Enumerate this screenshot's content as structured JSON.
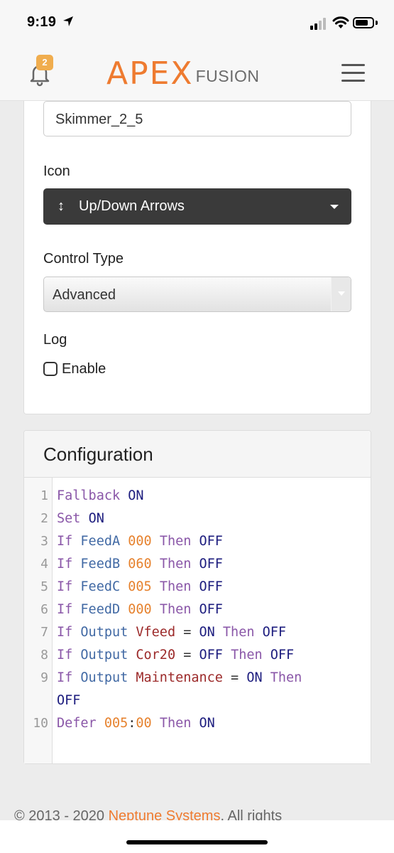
{
  "status_bar": {
    "time": "9:19"
  },
  "navbar": {
    "notification_count": "2",
    "logo_primary": "APEX",
    "logo_secondary": "FUSION"
  },
  "form": {
    "name_value": "Skimmer_2_5",
    "icon_label": "Icon",
    "icon_value": "Up/Down Arrows",
    "control_type_label": "Control Type",
    "control_type_value": "Advanced",
    "log_label": "Log",
    "enable_label": "Enable",
    "enable_checked": false
  },
  "configuration": {
    "title": "Configuration",
    "line_numbers": [
      "1",
      "2",
      "3",
      "4",
      "5",
      "6",
      "7",
      "8",
      "9",
      "",
      "10"
    ],
    "lines": [
      [
        [
          "kw",
          "Fallback "
        ],
        [
          "st",
          "ON"
        ]
      ],
      [
        [
          "kw",
          "Set "
        ],
        [
          "st",
          "ON"
        ]
      ],
      [
        [
          "kw",
          "If "
        ],
        [
          "var",
          "FeedA "
        ],
        [
          "num",
          "000 "
        ],
        [
          "kw",
          "Then "
        ],
        [
          "st",
          "OFF"
        ]
      ],
      [
        [
          "kw",
          "If "
        ],
        [
          "var",
          "FeedB "
        ],
        [
          "num",
          "060 "
        ],
        [
          "kw",
          "Then "
        ],
        [
          "st",
          "OFF"
        ]
      ],
      [
        [
          "kw",
          "If "
        ],
        [
          "var",
          "FeedC "
        ],
        [
          "num",
          "005 "
        ],
        [
          "kw",
          "Then "
        ],
        [
          "st",
          "OFF"
        ]
      ],
      [
        [
          "kw",
          "If "
        ],
        [
          "var",
          "FeedD "
        ],
        [
          "num",
          "000 "
        ],
        [
          "kw",
          "Then "
        ],
        [
          "st",
          "OFF"
        ]
      ],
      [
        [
          "kw",
          "If "
        ],
        [
          "var",
          "Output "
        ],
        [
          "out",
          "Vfeed "
        ],
        [
          "op",
          "= "
        ],
        [
          "st",
          "ON "
        ],
        [
          "kw",
          "Then "
        ],
        [
          "st",
          "OFF"
        ]
      ],
      [
        [
          "kw",
          "If "
        ],
        [
          "var",
          "Output "
        ],
        [
          "out",
          "Cor20 "
        ],
        [
          "op",
          "= "
        ],
        [
          "st",
          "OFF "
        ],
        [
          "kw",
          "Then "
        ],
        [
          "st",
          "OFF"
        ]
      ],
      [
        [
          "kw",
          "If "
        ],
        [
          "var",
          "Output "
        ],
        [
          "out",
          "Maintenance "
        ],
        [
          "op",
          "= "
        ],
        [
          "st",
          "ON "
        ],
        [
          "kw",
          "Then"
        ]
      ],
      [
        [
          "st",
          "OFF"
        ]
      ],
      [
        [
          "kw",
          "Defer "
        ],
        [
          "num",
          "005"
        ],
        [
          "op",
          ":"
        ],
        [
          "num",
          "00 "
        ],
        [
          "kw",
          "Then "
        ],
        [
          "st",
          "ON"
        ]
      ]
    ]
  },
  "footer": {
    "prefix": "© 2013 - 2020 ",
    "company": "Neptune Systems",
    "suffix": ". All rights"
  }
}
